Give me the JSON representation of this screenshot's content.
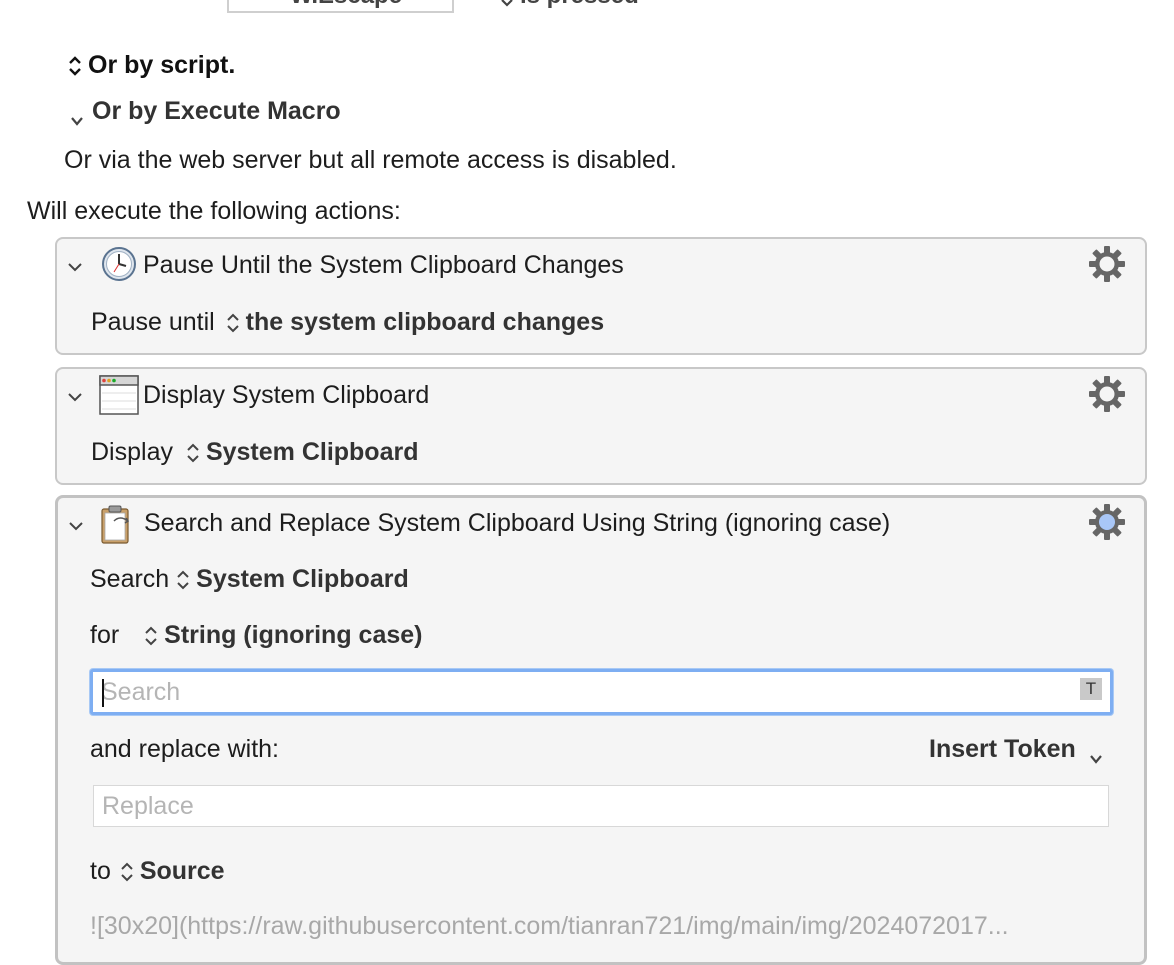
{
  "top_partial": {
    "key_label": "W.Escape",
    "pressed_label": "is pressed"
  },
  "triggers": {
    "by_script": "Or by script.",
    "by_execute_macro": "Or by Execute Macro",
    "web_server": "Or via the web server but all remote access is disabled."
  },
  "actions_heading": "Will execute the following actions:",
  "actions": [
    {
      "title": "Pause Until the System Clipboard Changes",
      "icon": "clock-icon",
      "prefix": "Pause until",
      "value": "the system clipboard changes"
    },
    {
      "title": "Display System Clipboard",
      "icon": "window-icon",
      "prefix": "Display",
      "value": "System Clipboard"
    },
    {
      "title": "Search and Replace System Clipboard Using String (ignoring case)",
      "icon": "clipboard-icon",
      "search_prefix": "Search",
      "search_value": "System Clipboard",
      "for_prefix": "for",
      "for_value": "String (ignoring case)",
      "search_placeholder": "Search",
      "token_badge": "T",
      "replace_label": "and replace with:",
      "insert_token": "Insert Token",
      "replace_placeholder": "Replace",
      "to_prefix": "to",
      "to_value": "Source",
      "source_text": "![30x20](https://raw.githubusercontent.com/tianran721/img/main/img/2024072017..."
    }
  ],
  "colors": {
    "focus_ring": "#7eaef2",
    "gear_selected": "#a9c7f7"
  }
}
